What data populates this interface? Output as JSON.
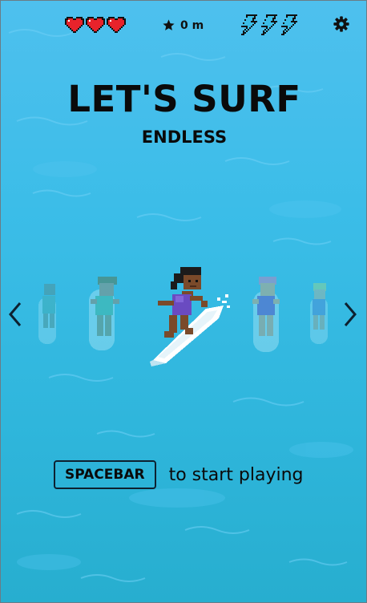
{
  "hud": {
    "lives": 3,
    "score": "0 m",
    "boosts": 3,
    "icons": [
      "heart-icon",
      "star-icon",
      "lightning-bolt-icon",
      "gear-icon"
    ]
  },
  "title": "LET'S SURF",
  "mode": "ENDLESS",
  "character_select": {
    "prev_icon": "chevron-left-icon",
    "next_icon": "chevron-right-icon"
  },
  "start_prompt": {
    "key": "SPACEBAR",
    "text": "to start playing"
  },
  "colors": {
    "water": "#3bbde8",
    "heart": "#e8232b",
    "text": "#0a0a0a"
  }
}
